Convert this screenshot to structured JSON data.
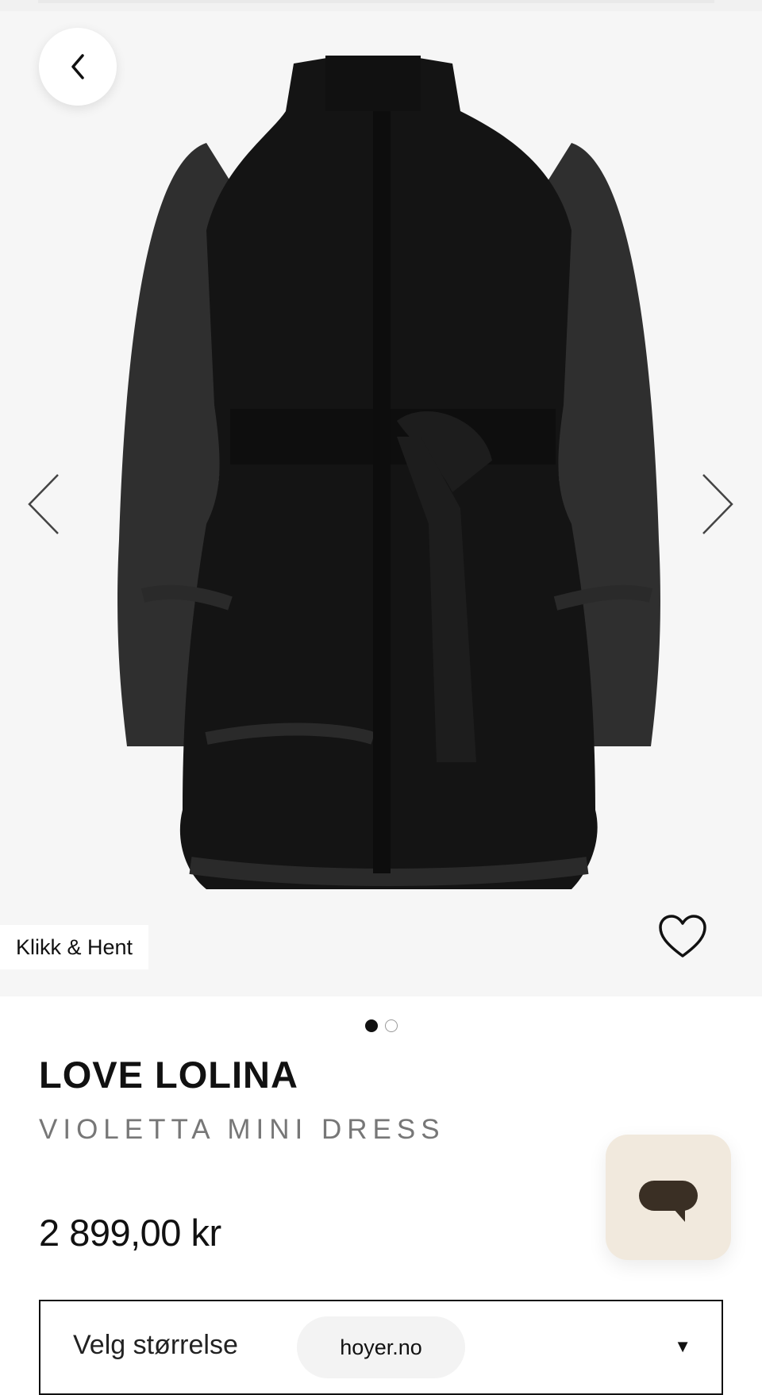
{
  "hero": {
    "pickup_badge": "Klikk & Hent",
    "image_count": 2,
    "active_image_index": 0
  },
  "product": {
    "brand": "LOVE LOLINA",
    "name": "VIOLETTA MINI DRESS",
    "price": "2 899,00 kr"
  },
  "size_select": {
    "label": "Velg størrelse"
  },
  "browser": {
    "url": "hoyer.no"
  },
  "icons": [
    "back-arrow-icon",
    "chevron-left-icon",
    "chevron-right-icon",
    "heart-icon",
    "chat-bubble-icon",
    "dropdown-caret-icon"
  ],
  "colors": {
    "hero_background": "#f6f6f6",
    "chat_button": "#f1e9dd",
    "chat_icon": "#3a2f24",
    "text_primary": "#111111",
    "text_secondary": "#777777"
  }
}
